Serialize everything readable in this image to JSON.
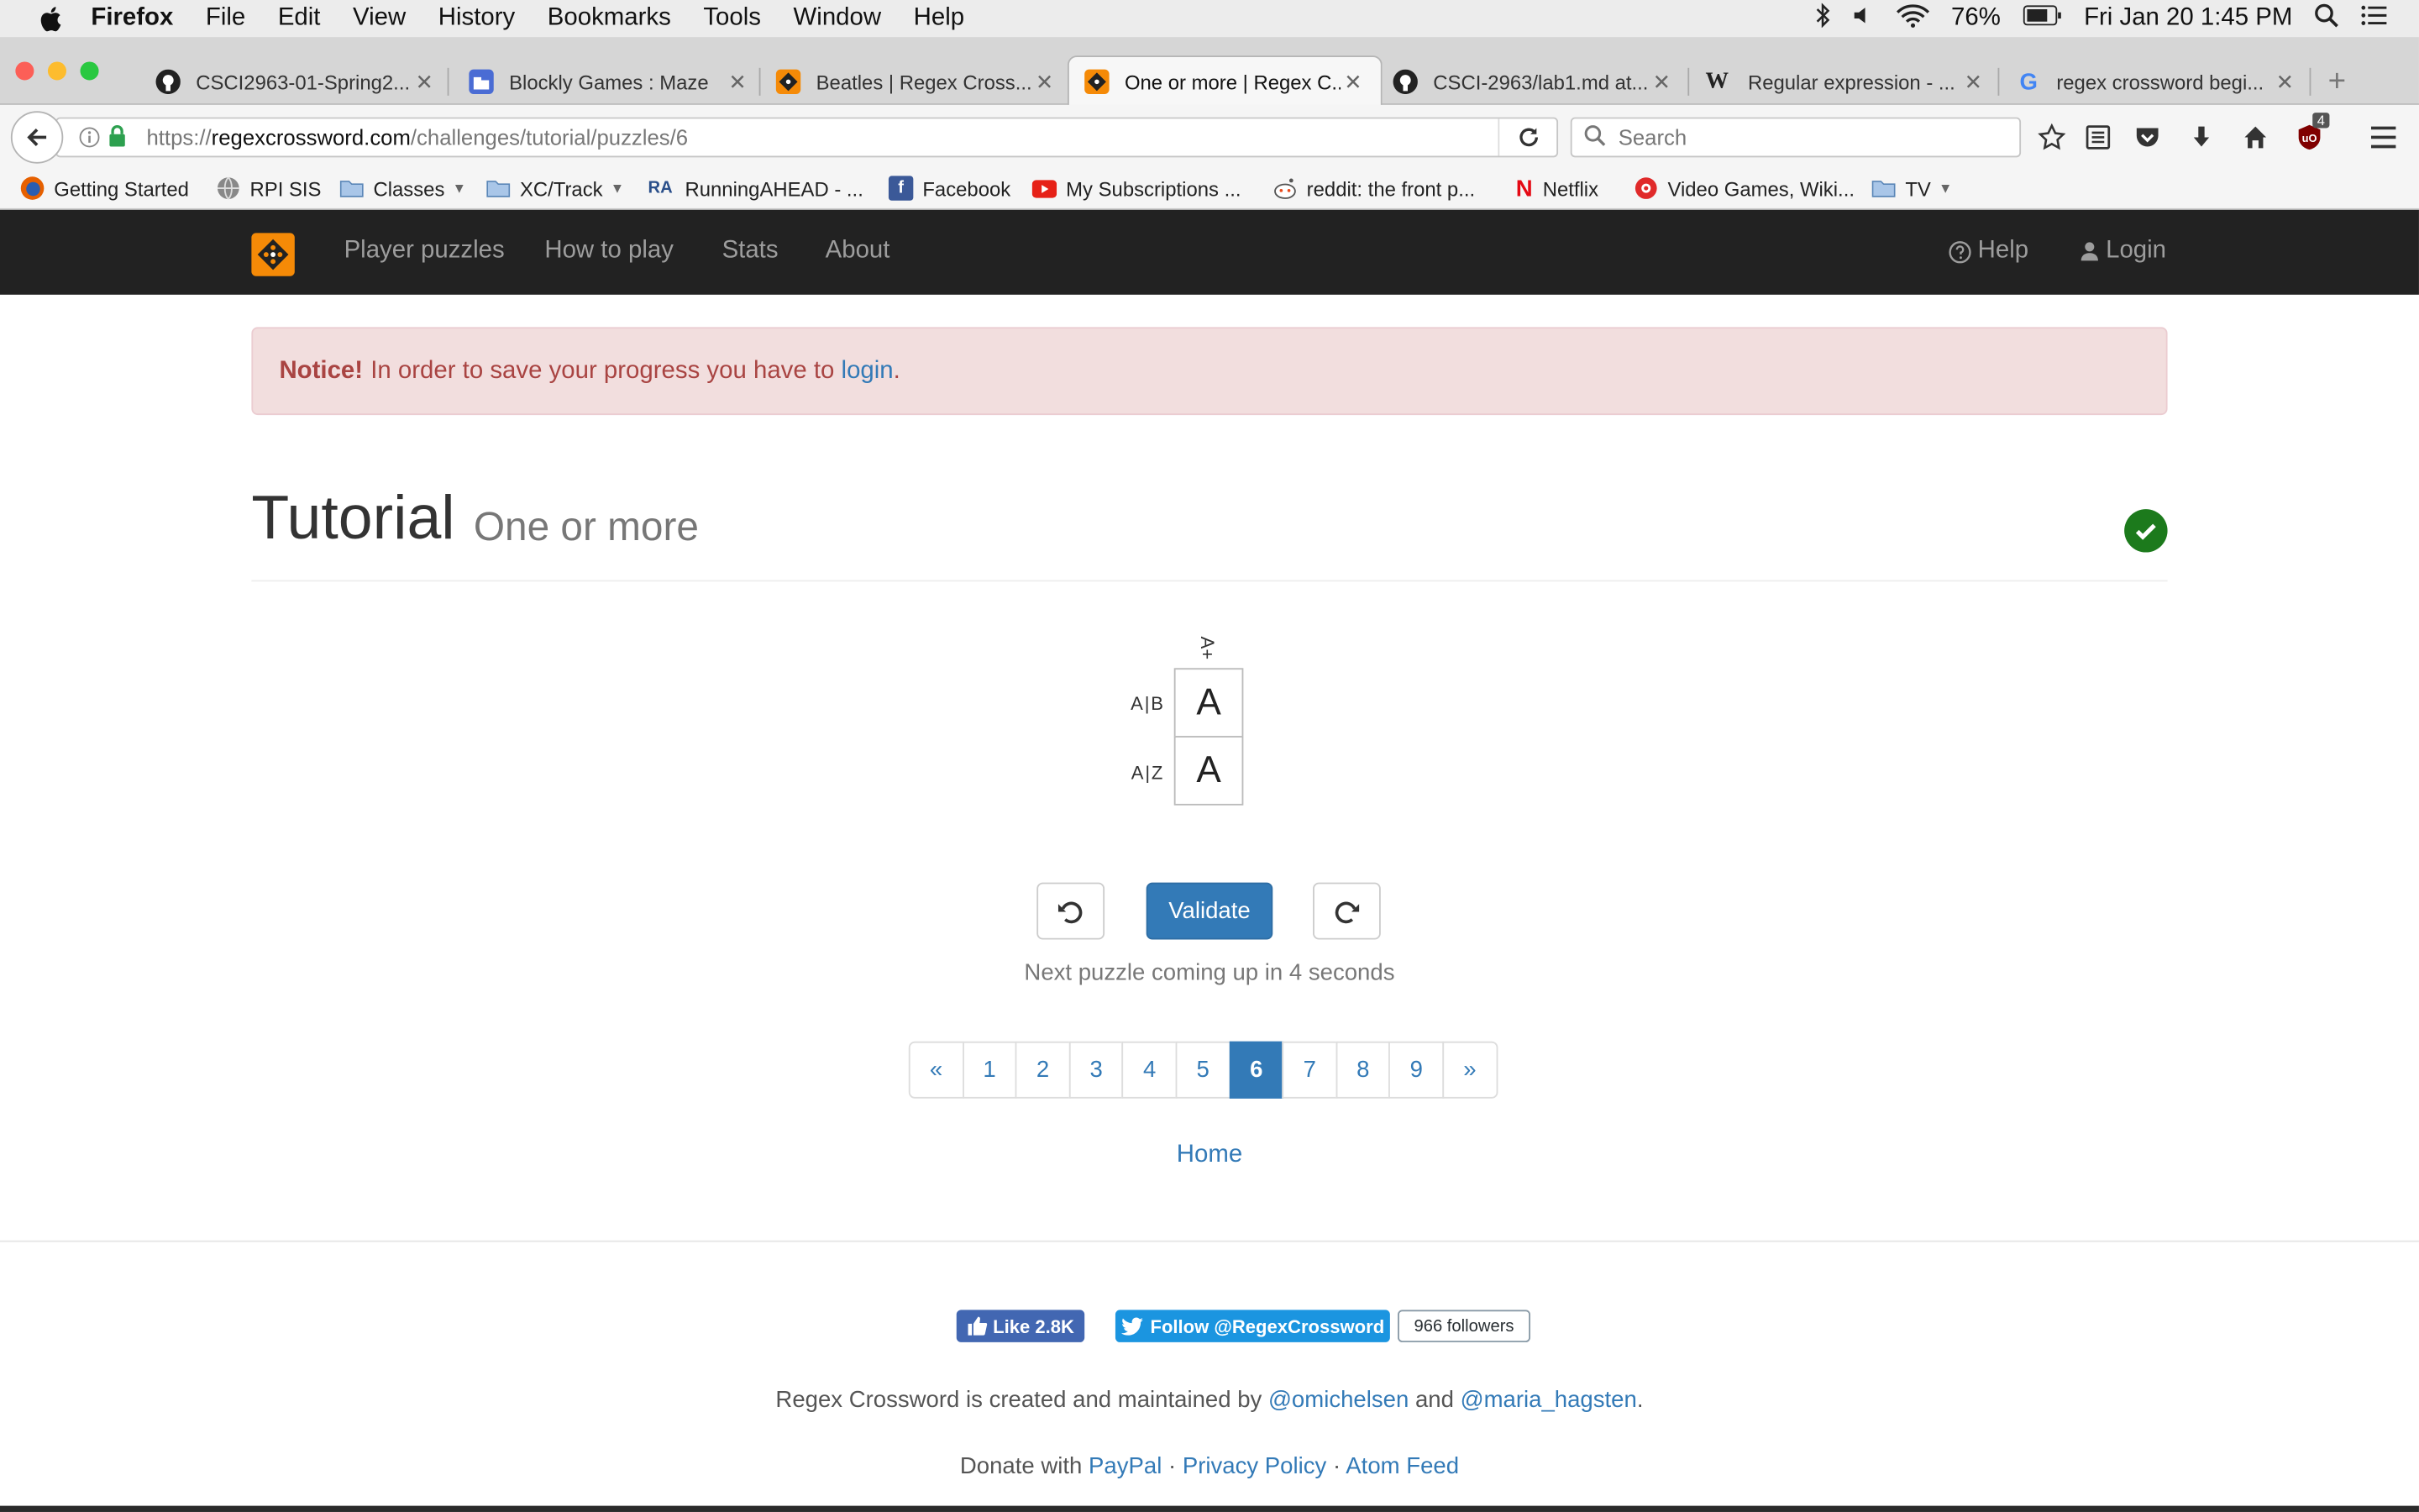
{
  "os_menubar": {
    "app_name": "Firefox",
    "items": [
      "File",
      "Edit",
      "View",
      "History",
      "Bookmarks",
      "Tools",
      "Window",
      "Help"
    ],
    "battery": "76%",
    "datetime": "Fri Jan 20  1:45 PM"
  },
  "tabs": [
    {
      "title": "CSCI2963-01-Spring2...",
      "icon": "github-icon"
    },
    {
      "title": "Blockly Games : Maze",
      "icon": "blockly-icon"
    },
    {
      "title": "Beatles | Regex Cross...",
      "icon": "regexcrossword-icon"
    },
    {
      "title": "One or more | Regex C...",
      "icon": "regexcrossword-icon",
      "active": true
    },
    {
      "title": "CSCI-2963/lab1.md at...",
      "icon": "github-icon"
    },
    {
      "title": "Regular expression - ...",
      "icon": "wikipedia-icon"
    },
    {
      "title": "regex crossword begi...",
      "icon": "google-icon"
    }
  ],
  "toolbar": {
    "url_prefix": "https://",
    "url_domain": "regexcrossword.com",
    "url_path": "/challenges/tutorial/puzzles/6",
    "search_placeholder": "Search",
    "ublock_badge": "4"
  },
  "bookmarks": [
    {
      "label": "Getting Started",
      "icon": "firefox-icon"
    },
    {
      "label": "RPI SIS",
      "icon": "globe-icon"
    },
    {
      "label": "Classes",
      "icon": "folder-icon",
      "dropdown": true
    },
    {
      "label": "XC/Track",
      "icon": "folder-icon",
      "dropdown": true
    },
    {
      "label": "RunningAHEAD - ...",
      "icon": "runningahead-icon",
      "icon_text": "RA"
    },
    {
      "label": "Facebook",
      "icon": "facebook-icon"
    },
    {
      "label": "My Subscriptions ...",
      "icon": "youtube-icon"
    },
    {
      "label": "reddit: the front p...",
      "icon": "reddit-icon"
    },
    {
      "label": "Netflix",
      "icon": "netflix-icon"
    },
    {
      "label": "Video Games, Wiki...",
      "icon": "gamefaqs-icon"
    },
    {
      "label": "TV",
      "icon": "folder-icon",
      "dropdown": true
    }
  ],
  "site_nav": {
    "links": [
      "Player puzzles",
      "How to play",
      "Stats",
      "About"
    ],
    "help": "Help",
    "login": "Login"
  },
  "notice": {
    "strong": "Notice!",
    "text": "In order to save your progress you have to",
    "link": "login",
    "end": "."
  },
  "header": {
    "title": "Tutorial",
    "subtitle": "One or more"
  },
  "puzzle": {
    "column_clue": "A+",
    "rows": [
      {
        "clue": "A|B",
        "value": "A"
      },
      {
        "clue": "A|Z",
        "value": "A"
      }
    ]
  },
  "actions": {
    "validate": "Validate",
    "next_message": "Next puzzle coming up in 4 seconds"
  },
  "pagination": {
    "prev": "«",
    "next": "»",
    "pages": [
      "1",
      "2",
      "3",
      "4",
      "5",
      "6",
      "7",
      "8",
      "9"
    ],
    "current": "6"
  },
  "home_link": "Home",
  "footer": {
    "fb_like": "Like 2.8K",
    "twitter_follow": "Follow @RegexCrossword",
    "followers": "966 followers",
    "credits_pre": "Regex Crossword is created and maintained by",
    "author1": "@omichelsen",
    "and": "and",
    "author2": "@maria_hagsten",
    "period": ".",
    "donate_pre": "Donate with",
    "paypal": "PayPal",
    "sep": "·",
    "privacy": "Privacy Policy",
    "atom": "Atom Feed"
  },
  "colors": {
    "brand_orange": "#f58a07",
    "navbar_bg": "#222222",
    "link_blue": "#337ab7",
    "notice_bg": "#f2dede",
    "notice_text": "#a94442",
    "success_green": "#1c7a1c"
  }
}
